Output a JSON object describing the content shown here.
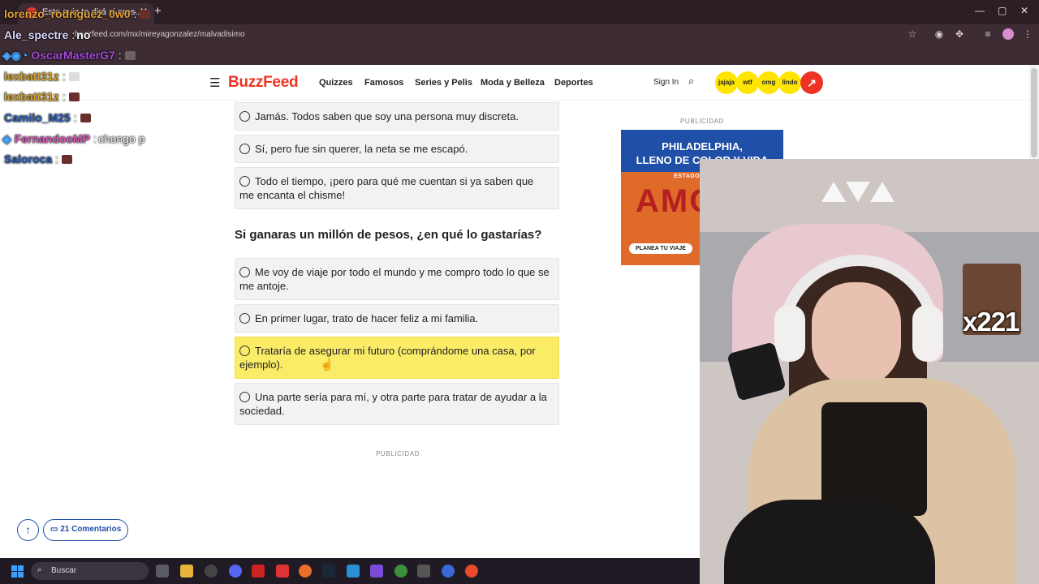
{
  "browser": {
    "tab_title": "Este quiz te dirá si eres...",
    "url": "buzzfeed.com/mx/mireyagonzalez/malvadisimo"
  },
  "site": {
    "logo": "BuzzFeed",
    "nav": [
      "Quizzes",
      "Famosos",
      "Series y Pelis",
      "Moda y Belleza",
      "Deportes"
    ],
    "sign_in": "Sign In",
    "badges": [
      "jajaja",
      "wtf",
      "omg",
      "lindo"
    ]
  },
  "quiz": {
    "prev_options": [
      "Jamás. Todos saben que soy una persona muy discreta.",
      "Sí, pero fue sin querer, la neta se me escapó.",
      "Todo el tiempo, ¡pero para qué me cuentan si ya saben que me encanta el chisme!"
    ],
    "question": "Si ganaras un millón de pesos, ¿en qué lo gastarías?",
    "options": [
      "Me voy de viaje por todo el mundo y me compro todo lo que se me antoje.",
      "En primer lugar, trato de hacer feliz a mi familia.",
      "Trataría de asegurar mi futuro (comprándome una casa, por ejemplo).",
      "Una parte sería para mí, y otra parte para tratar de ayudar a la sociedad."
    ],
    "hovered_option_index": 2
  },
  "ads": {
    "label": "PUBLICIDAD",
    "headline_1": "PHILADELPHIA,",
    "headline_2": "LLENO DE COLOR Y VIDA",
    "subline": "ESTADOS UNIDOS",
    "art_text": "AMOR",
    "cta": "PLANEA TU VIAJE"
  },
  "footer": {
    "comments_label": "21 Comentarios"
  },
  "taskbar": {
    "search_label": "Buscar"
  },
  "chat": [
    {
      "user": "lorenzo_rodriguez_0w0",
      "color": "#e2a23a",
      "message": "",
      "emote": true
    },
    {
      "user": "Ale_spectre",
      "color": "#d8d8ff",
      "message": "no",
      "emote": false
    },
    {
      "user": "OscarMasterG7",
      "color": "#a44ad8",
      "message": "",
      "emote": true
    },
    {
      "user": "lexbatt31z",
      "color": "#d4a028",
      "message": "",
      "emote": true
    },
    {
      "user": "lexbatt31z",
      "color": "#d4a028",
      "message": "",
      "emote": true
    },
    {
      "user": "Camilo_M25",
      "color": "#2d5fb8",
      "message": "",
      "emote": true
    },
    {
      "user": "FernandooMP",
      "color": "#d85ab8",
      "message": "chongo p",
      "emote": false
    },
    {
      "user": "Saloroca",
      "color": "#2d5fb8",
      "message": "",
      "emote": true
    }
  ],
  "webcam": {
    "combo_text": "x221"
  }
}
